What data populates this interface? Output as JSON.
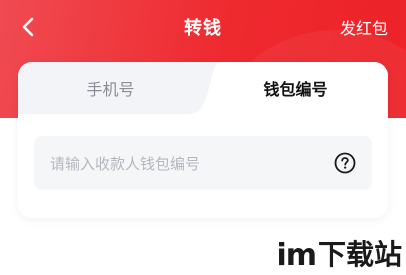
{
  "colors": {
    "header_red": "#ee2a2f",
    "inactive_tab_bg": "#f3f4f7",
    "input_bg": "#f5f6f8",
    "placeholder": "#b4b7bf"
  },
  "navbar": {
    "back_icon": "chevron-left-icon",
    "title": "转钱",
    "action_label": "发红包"
  },
  "tabs": [
    {
      "label": "手机号",
      "active": false
    },
    {
      "label": "钱包编号",
      "active": true
    }
  ],
  "wallet_input": {
    "placeholder": "请输入收款人钱包编号",
    "help_icon": "question-circle-icon"
  },
  "watermark": {
    "latin": "im",
    "chinese": "下载站"
  }
}
